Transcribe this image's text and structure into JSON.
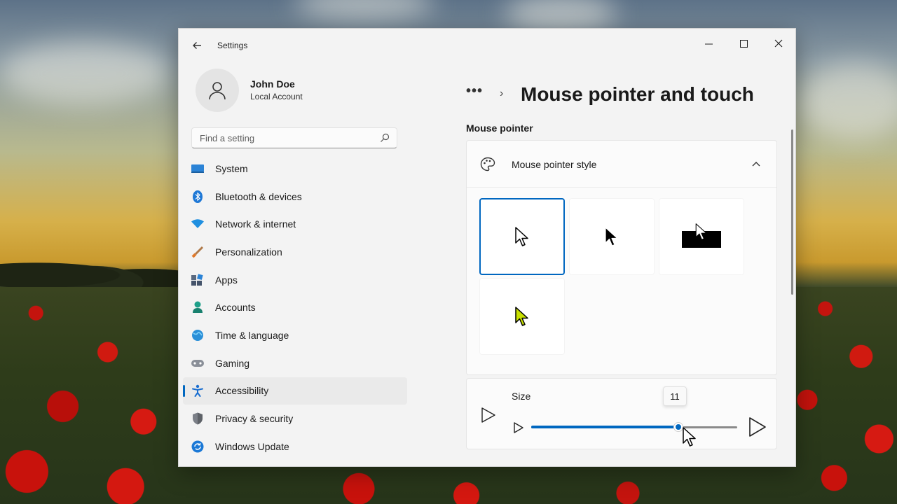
{
  "window": {
    "app_title": "Settings",
    "controls": {
      "minimize": "—"
    }
  },
  "user": {
    "name": "John Doe",
    "account_type": "Local Account"
  },
  "search": {
    "placeholder": "Find a setting",
    "value": ""
  },
  "sidebar": {
    "active_index": 8,
    "items": [
      {
        "label": "System",
        "icon": "system-icon"
      },
      {
        "label": "Bluetooth & devices",
        "icon": "bluetooth-icon"
      },
      {
        "label": "Network & internet",
        "icon": "wifi-icon"
      },
      {
        "label": "Personalization",
        "icon": "brush-icon"
      },
      {
        "label": "Apps",
        "icon": "apps-icon"
      },
      {
        "label": "Accounts",
        "icon": "person-icon"
      },
      {
        "label": "Time & language",
        "icon": "globe-icon"
      },
      {
        "label": "Gaming",
        "icon": "gamepad-icon"
      },
      {
        "label": "Accessibility",
        "icon": "accessibility-icon"
      },
      {
        "label": "Privacy & security",
        "icon": "shield-icon"
      },
      {
        "label": "Windows Update",
        "icon": "update-icon"
      }
    ]
  },
  "breadcrumb": {
    "overflow": "•••",
    "separator": "›"
  },
  "page": {
    "title": "Mouse pointer and touch",
    "section_label": "Mouse pointer"
  },
  "pointer_style": {
    "label": "Mouse pointer style",
    "expanded": true,
    "options": [
      {
        "name": "White",
        "selected": true
      },
      {
        "name": "Black",
        "selected": false
      },
      {
        "name": "Inverted",
        "selected": false
      },
      {
        "name": "Custom",
        "selected": false,
        "color": "#c8e000"
      }
    ]
  },
  "size": {
    "label": "Size",
    "value": "11",
    "min": 1,
    "max": 15
  },
  "colors": {
    "accent": "#0067c0",
    "custom_pointer": "#c8e000"
  }
}
